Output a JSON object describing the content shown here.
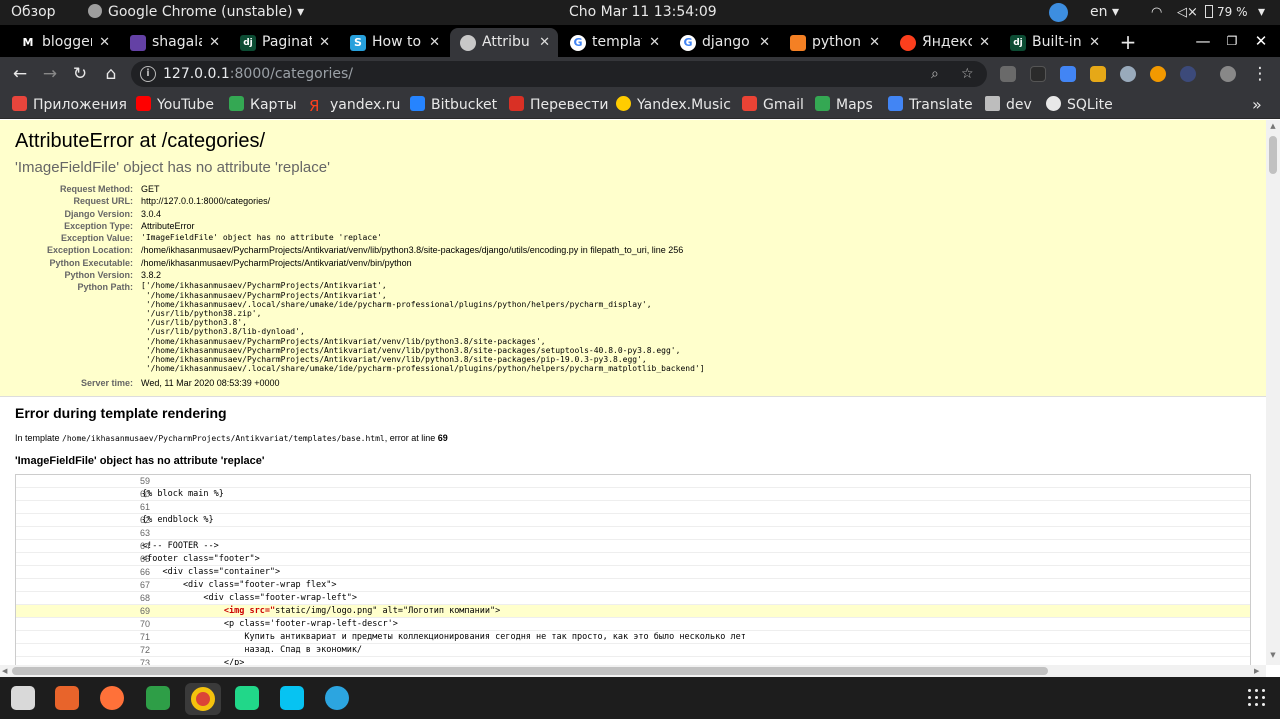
{
  "topbar": {
    "activities": "Обзор",
    "app_menu": "Google Chrome (unstable)",
    "clock": "Cho Mar 11  13:54:09",
    "language": "en",
    "battery": "79 %"
  },
  "tabs": [
    {
      "title": "blogger",
      "favicon_letter": "M",
      "active": false
    },
    {
      "title": "shagala",
      "favicon_letter": "",
      "active": false
    },
    {
      "title": "Paginat",
      "favicon_letter": "dj",
      "active": false
    },
    {
      "title": "How to",
      "favicon_letter": "S",
      "active": false
    },
    {
      "title": "Attribu",
      "favicon_letter": "",
      "active": true
    },
    {
      "title": "templat",
      "favicon_letter": "G",
      "active": false
    },
    {
      "title": "django",
      "favicon_letter": "G",
      "active": false
    },
    {
      "title": "python",
      "favicon_letter": "",
      "active": false
    },
    {
      "title": "Яндекс",
      "favicon_letter": "",
      "active": false
    },
    {
      "title": "Built-in",
      "favicon_letter": "dj",
      "active": false
    }
  ],
  "omnibox": {
    "url_host": "127.0.0.1",
    "url_rest": ":8000/categories/"
  },
  "bookmarks": [
    {
      "label": "Приложения",
      "color": "#e8453c"
    },
    {
      "label": "YouTube",
      "color": "#ff0000"
    },
    {
      "label": "Карты",
      "color": "#34a853"
    },
    {
      "label": "yandex.ru",
      "color": "#fc3f1d"
    },
    {
      "label": "Bitbucket",
      "color": "#2684ff"
    },
    {
      "label": "Перевести",
      "color": "#d93025"
    },
    {
      "label": "Yandex.Music",
      "color": "#ffcc00"
    },
    {
      "label": "Gmail",
      "color": "#ea4335"
    },
    {
      "label": "Maps",
      "color": "#34a853"
    },
    {
      "label": "Translate",
      "color": "#4285f4"
    },
    {
      "label": "dev",
      "color": "#bdbdbd"
    },
    {
      "label": "SQLite",
      "color": "#e8e8e8"
    }
  ],
  "error": {
    "title": "AttributeError at /categories/",
    "value": "'ImageFieldFile' object has no attribute 'replace'",
    "meta": [
      {
        "key": "Request Method:",
        "value": "GET"
      },
      {
        "key": "Request URL:",
        "value": "http://127.0.0.1:8000/categories/"
      },
      {
        "key": "Django Version:",
        "value": "3.0.4"
      },
      {
        "key": "Exception Type:",
        "value": "AttributeError"
      },
      {
        "key": "Exception Value:",
        "value": "'ImageFieldFile' object has no attribute 'replace'"
      },
      {
        "key": "Exception Location:",
        "value": "/home/ikhasanmusaev/PycharmProjects/Antikvariat/venv/lib/python3.8/site-packages/django/utils/encoding.py in filepath_to_uri, line 256"
      },
      {
        "key": "Python Executable:",
        "value": "/home/ikhasanmusaev/PycharmProjects/Antikvariat/venv/bin/python"
      },
      {
        "key": "Python Version:",
        "value": "3.8.2"
      }
    ],
    "python_path_key": "Python Path:",
    "python_path": [
      "['/home/ikhasanmusaev/PycharmProjects/Antikvariat',",
      " '/home/ikhasanmusaev/PycharmProjects/Antikvariat',",
      " '/home/ikhasanmusaev/.local/share/umake/ide/pycharm-professional/plugins/python/helpers/pycharm_display',",
      " '/usr/lib/python38.zip',",
      " '/usr/lib/python3.8',",
      " '/usr/lib/python3.8/lib-dynload',",
      " '/home/ikhasanmusaev/PycharmProjects/Antikvariat/venv/lib/python3.8/site-packages',",
      " '/home/ikhasanmusaev/PycharmProjects/Antikvariat/venv/lib/python3.8/site-packages/setuptools-40.8.0-py3.8.egg',",
      " '/home/ikhasanmusaev/PycharmProjects/Antikvariat/venv/lib/python3.8/site-packages/pip-19.0.3-py3.8.egg',",
      " '/home/ikhasanmusaev/.local/share/umake/ide/pycharm-professional/plugins/python/helpers/pycharm_matplotlib_backend']"
    ],
    "server_time_key": "Server time:",
    "server_time": "Wed, 11 Mar 2020 08:53:39 +0000"
  },
  "template": {
    "heading": "Error during template rendering",
    "in_template_prefix": "In template ",
    "template_path": "/home/ikhasanmusaev/PycharmProjects/Antikvariat/templates/base.html",
    "error_at_line_text": ", error at line ",
    "error_line": "69",
    "message": "'ImageFieldFile' object has no attribute 'replace'",
    "lines": [
      {
        "num": "59",
        "code": "",
        "hl": false
      },
      {
        "num": "60",
        "code": "{% block main %}",
        "hl": false
      },
      {
        "num": "61",
        "code": "",
        "hl": false
      },
      {
        "num": "62",
        "code": "{% endblock %}",
        "hl": false
      },
      {
        "num": "63",
        "code": "",
        "hl": false
      },
      {
        "num": "64",
        "code": "<!-- FOOTER -->",
        "hl": false
      },
      {
        "num": "65",
        "code": "<footer class=\"footer\">",
        "hl": false
      },
      {
        "num": "66",
        "code": "    <div class=\"container\">",
        "hl": false
      },
      {
        "num": "67",
        "code": "        <div class=\"footer-wrap flex\">",
        "hl": false
      },
      {
        "num": "68",
        "code": "            <div class=\"footer-wrap-left\">",
        "hl": false
      },
      {
        "num": "69",
        "code_pre": "                ",
        "code_err": "<img src=\"",
        "code_post": "static/img/logo.png\" alt=\"Логотип компании\">",
        "hl": true
      },
      {
        "num": "70",
        "code": "                <p class='footer-wrap-left-descr'>",
        "hl": false
      },
      {
        "num": "71",
        "code": "                    Купить антиквариат и предметы коллекционирования сегодня не так просто, как это было несколько лет",
        "hl": false
      },
      {
        "num": "72",
        "code": "                    назад. Спад в экономик/",
        "hl": false
      },
      {
        "num": "73",
        "code": "                </p>",
        "hl": false
      }
    ]
  }
}
